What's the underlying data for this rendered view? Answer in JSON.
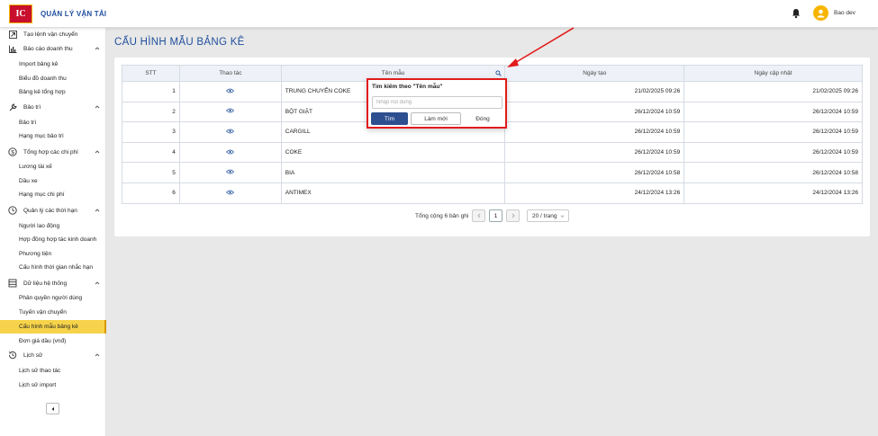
{
  "header": {
    "logo_text": "IC",
    "app_title": "QUẢN LÝ VẬN TẢI",
    "user_name": "Bao dev",
    "icons": {
      "notification": "bell-icon",
      "avatar": "user-avatar-icon"
    }
  },
  "sidebar": {
    "top_item": {
      "label": "Tạo lệnh vận chuyển",
      "icon": "arrow-box-icon"
    },
    "groups": [
      {
        "label": "Báo cáo doanh thu",
        "icon": "bar-chart-icon",
        "items": [
          "Import bảng kê",
          "Biểu đồ doanh thu",
          "Bảng kê tổng hợp"
        ]
      },
      {
        "label": "Bảo trì",
        "icon": "wrench-icon",
        "items": [
          "Bảo trì",
          "Hạng mục bảo trì"
        ]
      },
      {
        "label": "Tổng hợp các chi phí",
        "icon": "dollar-icon",
        "items": [
          "Lương tài xế",
          "Dầu xe",
          "Hạng mục chi phí"
        ]
      },
      {
        "label": "Quản lý các thời hạn",
        "icon": "clock-icon",
        "items": [
          "Người lao động",
          "Hợp đồng hợp tác kinh doanh",
          "Phương tiện",
          "Cấu hình thời gian nhắc hạn"
        ]
      },
      {
        "label": "Dữ liệu hệ thống",
        "icon": "database-icon",
        "items": [
          "Phân quyền người dùng",
          "Tuyến vận chuyển",
          "Cấu hình mẫu bảng kê",
          "Đơn giá dầu (vnđ)"
        ]
      },
      {
        "label": "Lịch sử",
        "icon": "history-icon",
        "items": [
          "Lịch sử thao tác",
          "Lịch sử import"
        ]
      }
    ],
    "active_item": "Cấu hình mẫu bảng kê",
    "collapse_icon": "collapse-left-icon"
  },
  "main": {
    "page_title": "CẤU HÌNH MẪU BẢNG KÊ",
    "table": {
      "columns": [
        "STT",
        "Thao tác",
        "Tên mẫu",
        "Ngày tạo",
        "Ngày cập nhật"
      ],
      "rows": [
        {
          "stt": "1",
          "name": "TRUNG CHUYỂN COKE",
          "created": "21/02/2025 09:26",
          "updated": "21/02/2025 09:26"
        },
        {
          "stt": "2",
          "name": "BỘT GIẶT",
          "created": "26/12/2024 10:59",
          "updated": "26/12/2024 10:59"
        },
        {
          "stt": "3",
          "name": "CARGILL",
          "created": "26/12/2024 10:59",
          "updated": "26/12/2024 10:59"
        },
        {
          "stt": "4",
          "name": "COKE",
          "created": "26/12/2024 10:59",
          "updated": "26/12/2024 10:59"
        },
        {
          "stt": "5",
          "name": "BIA",
          "created": "26/12/2024 10:58",
          "updated": "26/12/2024 10:58"
        },
        {
          "stt": "6",
          "name": "ANTIMEX",
          "created": "24/12/2024 13:26",
          "updated": "24/12/2024 13:26"
        }
      ],
      "action_icon": "eye-icon",
      "filter_icon": "search-icon"
    },
    "pagination": {
      "total_text": "Tổng cộng 6 bản ghi",
      "current_page": "1",
      "page_size": "20 / trang",
      "prev_icon": "chevron-left-icon",
      "next_icon": "chevron-right-icon"
    }
  },
  "filter_popup": {
    "title": "Tìm kiếm theo \"Tên mẫu\"",
    "placeholder": "Nhập nội dung",
    "value": "",
    "search_label": "Tìm",
    "reset_label": "Làm mới",
    "close_label": "Đóng"
  },
  "colors": {
    "brand_blue": "#1f4e9c",
    "button_blue": "#2d4f8f",
    "active_yellow": "#f6d34a",
    "highlight_red": "#e21b1b",
    "avatar_yellow": "#f7b500"
  }
}
